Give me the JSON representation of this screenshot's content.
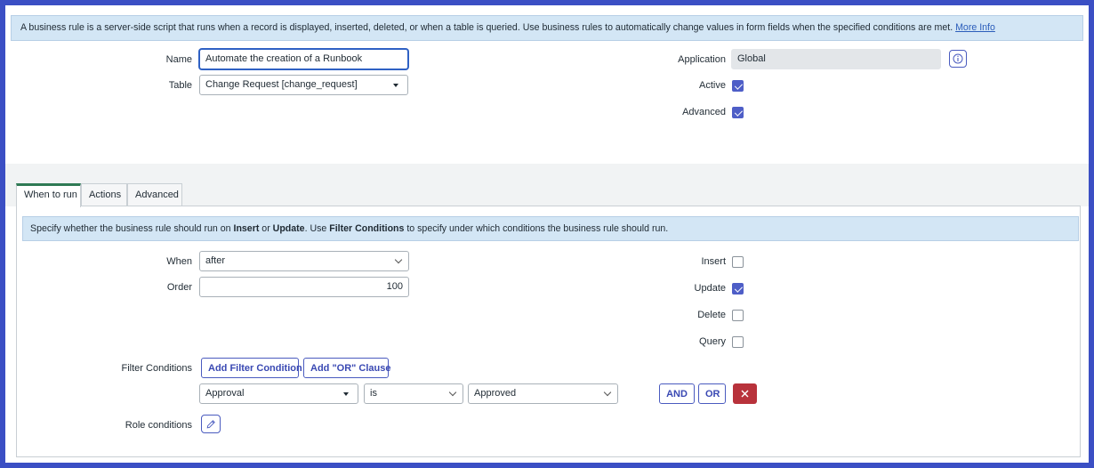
{
  "top_info": {
    "text": "A business rule is a server-side script that runs when a record is displayed, inserted, deleted, or when a table is queried. Use business rules to automatically change values in form fields when the specified conditions are met.",
    "link": "More Info"
  },
  "form": {
    "name_label": "Name",
    "name_value": "Automate the creation of a Runbook",
    "table_label": "Table",
    "table_value": "Change Request [change_request]",
    "application_label": "Application",
    "application_value": "Global",
    "active_label": "Active",
    "active_checked": true,
    "advanced_label": "Advanced",
    "advanced_checked": true
  },
  "tabs": [
    {
      "label": "When to run",
      "active": true
    },
    {
      "label": "Actions",
      "active": false
    },
    {
      "label": "Advanced",
      "active": false
    }
  ],
  "when_to_run": {
    "info_prefix": "Specify whether the business rule should run on ",
    "info_insert": "Insert",
    "info_or": " or ",
    "info_update": "Update",
    "info_use": ". Use ",
    "info_filter": "Filter Conditions",
    "info_suffix": " to specify under which conditions the business rule should run.",
    "when_label": "When",
    "when_value": "after",
    "order_label": "Order",
    "order_value": "100",
    "insert_label": "Insert",
    "insert_checked": false,
    "update_label": "Update",
    "update_checked": true,
    "delete_label": "Delete",
    "delete_checked": false,
    "query_label": "Query",
    "query_checked": false,
    "filter_label": "Filter Conditions",
    "add_filter_button": "Add Filter Condition",
    "add_or_button": "Add \"OR\" Clause",
    "condition_field": "Approval",
    "condition_operator": "is",
    "condition_value": "Approved",
    "and_button": "AND",
    "or_button": "OR",
    "role_label": "Role conditions"
  },
  "colors": {
    "frame": "#3b4fc4",
    "info_bg": "#d3e6f5",
    "accent": "#4e5ec7",
    "danger": "#b8323b",
    "active_tab": "#2f7a54"
  },
  "icons": {
    "info": "info-circle-icon",
    "delete": "close-icon",
    "edit": "pencil-icon"
  }
}
